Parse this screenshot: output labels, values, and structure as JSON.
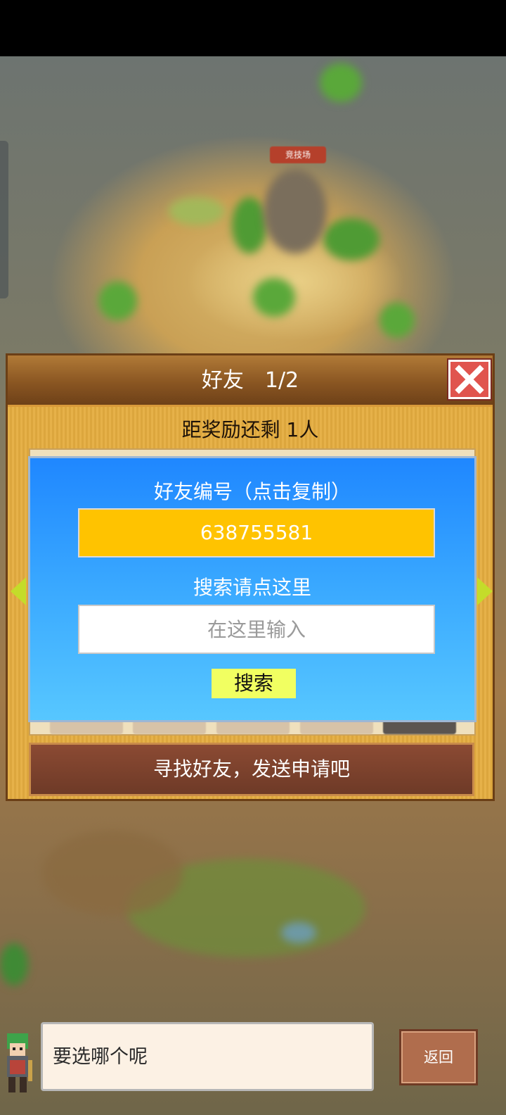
{
  "map": {
    "location_label": "竞技场"
  },
  "dialog": {
    "title": "好友　1/2",
    "close_icon": "close-x-icon",
    "reward_text": "距奖励还剩 1人",
    "popup": {
      "id_label": "好友编号（点击复制）",
      "friend_id": "638755581",
      "search_label": "搜索请点这里",
      "search_placeholder": "在这里输入",
      "search_button": "搜索"
    },
    "find_button": "寻找好友，发送申请吧"
  },
  "footer": {
    "prompt": "要选哪个呢",
    "back_button": "返回"
  },
  "colors": {
    "panel": "#e5ad3f",
    "popup_blue": "#1f87ff",
    "id_box": "#ffc300",
    "search_button": "#f1ff61",
    "close_red": "#e0544e"
  }
}
